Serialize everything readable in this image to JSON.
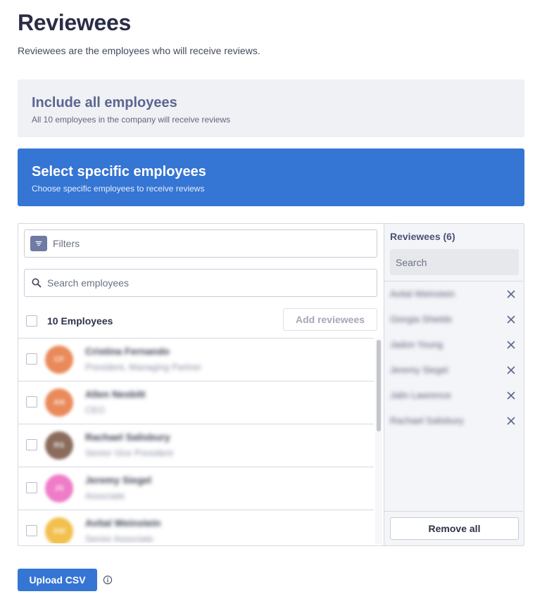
{
  "page": {
    "title": "Reviewees",
    "subtitle": "Reviewees are the employees who will receive reviews."
  },
  "options": {
    "all": {
      "title": "Include all employees",
      "description": "All 10 employees in the company will receive reviews",
      "selected": false
    },
    "specific": {
      "title": "Select specific employees",
      "description": "Choose specific employees to receive reviews",
      "selected": true
    }
  },
  "selector": {
    "filters_placeholder": "Filters",
    "search_placeholder": "Search employees",
    "employee_count_label": "10 Employees",
    "add_button": "Add reviewees",
    "employees": [
      {
        "initials": "CF",
        "name": "Cristina Fernando",
        "title": "President, Managing Partner",
        "avatar_color": "#ea8a5a"
      },
      {
        "initials": "AN",
        "name": "Allen Nesbitt",
        "title": "CEO",
        "avatar_color": "#ea8a5a"
      },
      {
        "initials": "RS",
        "name": "Rachael Salisbury",
        "title": "Senior Vice President",
        "avatar_color": "#8a6b5c"
      },
      {
        "initials": "JS",
        "name": "Jeremy Siegel",
        "title": "Associate",
        "avatar_color": "#ef7cc7"
      },
      {
        "initials": "AW",
        "name": "Avital Weinstein",
        "title": "Senior Associate",
        "avatar_color": "#f2c04e"
      }
    ]
  },
  "reviewees": {
    "title": "Reviewees (6)",
    "search_placeholder": "Search",
    "items": [
      "Avital Weinstein",
      "Giorgia Shields",
      "Jadon Young",
      "Jeremy Siegel",
      "Jalin Lawrence",
      "Rachael Salisbury"
    ],
    "remove_all": "Remove all"
  },
  "footer": {
    "upload_button": "Upload CSV"
  },
  "colors": {
    "accent": "#3575d3",
    "inactive_card": "#f0f1f4"
  }
}
